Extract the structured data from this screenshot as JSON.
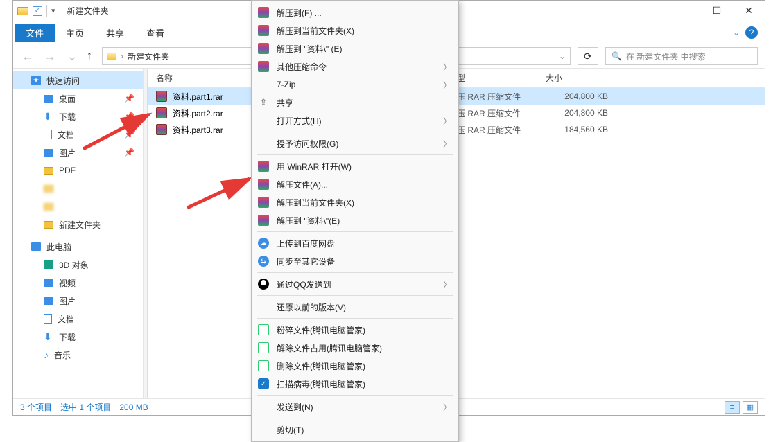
{
  "window": {
    "title": "新建文件夹",
    "min": "—",
    "max": "☐",
    "close": "✕"
  },
  "ribbon": {
    "file": "文件",
    "home": "主页",
    "share": "共享",
    "view": "查看"
  },
  "nav": {
    "back": "←",
    "forward": "→",
    "dropdown": "⌄",
    "up": "↑",
    "crumb_root_sep": "›",
    "crumb": "新建文件夹",
    "refresh": "⟳",
    "search_placeholder": "在 新建文件夹 中搜索",
    "search_icon": "🔍"
  },
  "sidebar": {
    "quick": "快速访问",
    "desktop": "桌面",
    "downloads": "下载",
    "documents": "文档",
    "pictures": "图片",
    "pdf": "PDF",
    "blur1": " ",
    "blur2": " ",
    "newfolder": "新建文件夹",
    "thispc": "此电脑",
    "objects3d": "3D 对象",
    "videos": "视频",
    "pictures2": "图片",
    "documents2": "文档",
    "downloads2": "下载",
    "music": "音乐",
    "pin": "📌"
  },
  "columns": {
    "name": "名称",
    "type": "类型",
    "size": "大小"
  },
  "files": [
    {
      "name": "资料.part1.rar",
      "type": "好压 RAR 压缩文件",
      "size": "204,800 KB",
      "selected": true
    },
    {
      "name": "资料.part2.rar",
      "type": "好压 RAR 压缩文件",
      "size": "204,800 KB",
      "selected": false
    },
    {
      "name": "资料.part3.rar",
      "type": "好压 RAR 压缩文件",
      "size": "184,560 KB",
      "selected": false
    }
  ],
  "status": {
    "count": "3 个项目",
    "selection": "选中 1 个项目",
    "size": "200 MB"
  },
  "ctx": {
    "extract_to_f": "解压到(F) ...",
    "extract_here_x": "解压到当前文件夹(X)",
    "extract_to_folder_e": "解压到 \"资料\\\" (E)",
    "other_compress": "其他压缩命令",
    "sevenzip": "7-Zip",
    "share": "共享",
    "open_with_h": "打开方式(H)",
    "grant_access_g": "授予访问权限(G)",
    "open_winrar_w": "用 WinRAR 打开(W)",
    "extract_files_a": "解压文件(A)...",
    "extract_here_x2": "解压到当前文件夹(X)",
    "extract_to_folder_e2": "解压到 \"资料\\\"(E)",
    "upload_baidu": "上传到百度网盘",
    "sync_devices": "同步至其它设备",
    "send_qq": "通过QQ发送到",
    "restore_v": "还原以前的版本(V)",
    "shred": "粉碎文件(腾讯电脑管家)",
    "unlock": "解除文件占用(腾讯电脑管家)",
    "delete": "删除文件(腾讯电脑管家)",
    "scan": "扫描病毒(腾讯电脑管家)",
    "send_to_n": "发送到(N)",
    "cut_t": "剪切(T)"
  }
}
